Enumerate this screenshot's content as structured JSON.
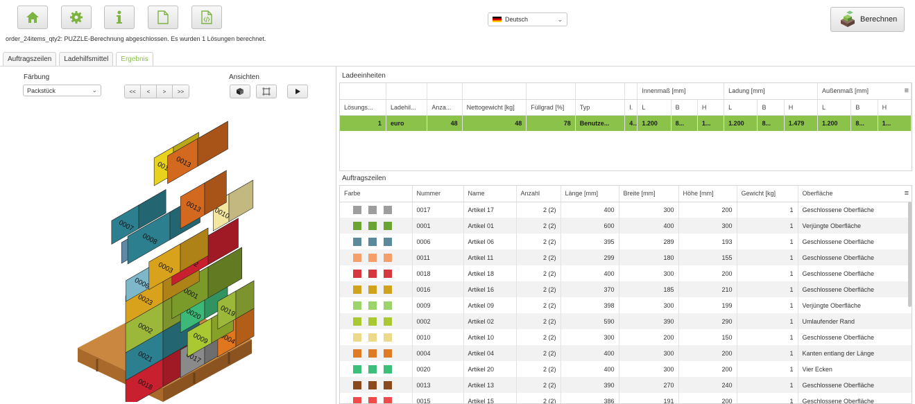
{
  "toolbar": {
    "icons": [
      "home-icon",
      "gear-icon",
      "info-icon",
      "document-icon",
      "code-file-icon"
    ],
    "language": "Deutsch",
    "calculate_label": "Berechnen",
    "status": "order_24items_qty2:  PUZZLE-Berechnung abgeschlossen. Es wurden 1 Lösungen berechnet."
  },
  "tabs": [
    "Auftragszeilen",
    "Ladehilfsmittel",
    "Ergebnis"
  ],
  "left": {
    "coloring_label": "Färbung",
    "coloring_value": "Packstück",
    "views_label": "Ansichten",
    "nav": [
      "<<",
      "<",
      ">",
      ">>"
    ]
  },
  "colors": {
    "accent": "#8bc34a",
    "pallet_wood": "#b5651d"
  },
  "boxes": [
    {
      "label": "0013",
      "color": "#d2691e"
    },
    {
      "label": "0016",
      "color": "#e8d21d"
    },
    {
      "label": "0007",
      "color": "#2c7f8f"
    },
    {
      "label": "0008",
      "color": "#2c7f8f"
    },
    {
      "label": "0010",
      "color": "#f2e6a0"
    },
    {
      "label": "0024",
      "color": "#5c8aa8"
    },
    {
      "label": "0003",
      "color": "#d9a21c"
    },
    {
      "label": "0022",
      "color": "#c8202e"
    },
    {
      "label": "0006",
      "color": "#7db7c9"
    },
    {
      "label": "0023",
      "color": "#d9a21c"
    },
    {
      "label": "0001",
      "color": "#7a9a2a"
    },
    {
      "label": "0002",
      "color": "#9cb83a"
    },
    {
      "label": "0019",
      "color": "#9cb83a"
    },
    {
      "label": "0020",
      "color": "#3cb878"
    },
    {
      "label": "0021",
      "color": "#2c7f8f"
    },
    {
      "label": "0009",
      "color": "#a9c832"
    },
    {
      "label": "0004",
      "color": "#e0761e"
    },
    {
      "label": "0017",
      "color": "#8a8a8a"
    },
    {
      "label": "0018",
      "color": "#c8202e"
    }
  ],
  "ladeeinheiten": {
    "title": "Ladeeinheiten",
    "group_headers": [
      "Innenmaß [mm]",
      "Ladung [mm]",
      "Außenmaß [mm]"
    ],
    "columns": [
      "Lösungs...",
      "Ladehil...",
      "Anza...",
      "Nettogewicht [kg]",
      "Füllgrad [%]",
      "Typ",
      "I.",
      "L",
      "B",
      "H",
      "L",
      "B",
      "H",
      "L",
      "B",
      "H"
    ],
    "row": [
      "1",
      "euro",
      "48",
      "48",
      "78",
      "Benutze...",
      "4...",
      "1.200",
      "8...",
      "1...",
      "1.200",
      "8...",
      "1.479",
      "1.200",
      "8...",
      "1..."
    ]
  },
  "auftragszeilen": {
    "title": "Auftragszeilen",
    "columns": [
      "Farbe",
      "Nummer",
      "Name",
      "Anzahl",
      "Länge [mm]",
      "Breite [mm]",
      "Höhe [mm]",
      "Gewicht [kg]",
      "Oberfläche"
    ],
    "rows": [
      {
        "color": "#9e9e9e",
        "nummer": "0017",
        "name": "Artikel 17",
        "anzahl": "2 (2)",
        "laenge": "400",
        "breite": "300",
        "hoehe": "200",
        "gewicht": "1",
        "oberflaeche": "Geschlossene Oberfläche"
      },
      {
        "color": "#6aa534",
        "nummer": "0001",
        "name": "Artikel 01",
        "anzahl": "2 (2)",
        "laenge": "600",
        "breite": "400",
        "hoehe": "300",
        "gewicht": "1",
        "oberflaeche": "Verjüngte Oberfläche"
      },
      {
        "color": "#5b8a9a",
        "nummer": "0006",
        "name": "Artikel 06",
        "anzahl": "2 (2)",
        "laenge": "395",
        "breite": "289",
        "hoehe": "193",
        "gewicht": "1",
        "oberflaeche": "Geschlossene Oberfläche"
      },
      {
        "color": "#f5a06a",
        "nummer": "0011",
        "name": "Artikel 11",
        "anzahl": "2 (2)",
        "laenge": "299",
        "breite": "180",
        "hoehe": "155",
        "gewicht": "1",
        "oberflaeche": "Geschlossene Oberfläche"
      },
      {
        "color": "#d7373f",
        "nummer": "0018",
        "name": "Artikel 18",
        "anzahl": "2 (2)",
        "laenge": "400",
        "breite": "300",
        "hoehe": "200",
        "gewicht": "1",
        "oberflaeche": "Geschlossene Oberfläche"
      },
      {
        "color": "#d1a31c",
        "nummer": "0016",
        "name": "Artikel 16",
        "anzahl": "2 (2)",
        "laenge": "370",
        "breite": "185",
        "hoehe": "210",
        "gewicht": "1",
        "oberflaeche": "Geschlossene Oberfläche"
      },
      {
        "color": "#9bd46a",
        "nummer": "0009",
        "name": "Artikel 09",
        "anzahl": "2 (2)",
        "laenge": "398",
        "breite": "300",
        "hoehe": "199",
        "gewicht": "1",
        "oberflaeche": "Verjüngte Oberfläche"
      },
      {
        "color": "#a9c832",
        "nummer": "0002",
        "name": "Artikel 02",
        "anzahl": "2 (2)",
        "laenge": "590",
        "breite": "390",
        "hoehe": "290",
        "gewicht": "1",
        "oberflaeche": "Umlaufender Rand"
      },
      {
        "color": "#ecd98a",
        "nummer": "0010",
        "name": "Artikel 10",
        "anzahl": "2 (2)",
        "laenge": "300",
        "breite": "200",
        "hoehe": "150",
        "gewicht": "1",
        "oberflaeche": "Geschlossene Oberfläche"
      },
      {
        "color": "#df7a25",
        "nummer": "0004",
        "name": "Artikel 04",
        "anzahl": "2 (2)",
        "laenge": "400",
        "breite": "300",
        "hoehe": "200",
        "gewicht": "1",
        "oberflaeche": "Kanten entlang der Länge"
      },
      {
        "color": "#3dbf7c",
        "nummer": "0020",
        "name": "Artikel 20",
        "anzahl": "2 (2)",
        "laenge": "400",
        "breite": "300",
        "hoehe": "200",
        "gewicht": "1",
        "oberflaeche": "Vier Ecken"
      },
      {
        "color": "#8a4a1e",
        "nummer": "0013",
        "name": "Artikel 13",
        "anzahl": "2 (2)",
        "laenge": "390",
        "breite": "270",
        "hoehe": "240",
        "gewicht": "1",
        "oberflaeche": "Geschlossene Oberfläche"
      },
      {
        "color": "#f04a4a",
        "nummer": "0015",
        "name": "Artikel 15",
        "anzahl": "2 (2)",
        "laenge": "386",
        "breite": "191",
        "hoehe": "200",
        "gewicht": "1",
        "oberflaeche": "Geschlossene Oberfläche"
      }
    ]
  }
}
